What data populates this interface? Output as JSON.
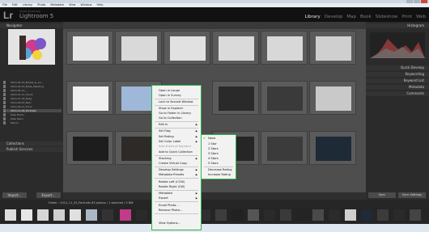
{
  "window": {
    "title": "Lightroom 5 Catalog - Adobe Photoshop Lightroom - Library"
  },
  "menubar": [
    "File",
    "Edit",
    "Library",
    "Photo",
    "Metadata",
    "View",
    "Window",
    "Help"
  ],
  "identity": {
    "logo": "Lr",
    "product": "Lightroom 5",
    "sub": "Adobe Photoshop"
  },
  "modules": [
    "Library",
    "Develop",
    "Map",
    "Book",
    "Slideshow",
    "Print",
    "Web"
  ],
  "left_panel": {
    "navigator": "Navigator",
    "folders": [
      "2014-04-14_Brides_&_Co...",
      "2014-04-16_Bella_Wedding",
      "2014-05-12_...",
      "2014-07-11_Shoot",
      "2014-07-18_Baby",
      "2014-09-03_Bert",
      "2014-09-11_Prom",
      "2014-11-03_Portraits",
      "Kate Farms",
      "Kate Stern",
      "Manon"
    ],
    "collections": "Collections",
    "publish": "Publish Services",
    "import": "Import...",
    "export": "Export..."
  },
  "right_panel": {
    "histogram": "Histogram",
    "quick_develop": "Quick Develop",
    "keywording": "Keywording",
    "keyword_list": "Keyword List",
    "metadata": "Metadata",
    "comments": "Comments",
    "sync": "Sync",
    "sync_settings": "Sync Settings"
  },
  "filmstrip": {
    "info": "Folder : 2014_11_03_Portraits  63 photos / 1 selected / 0 BW"
  },
  "context_menu": {
    "items": [
      "Open in Loupe",
      "Open in Survey",
      "Lock to Second Window",
      "Show in Explorer",
      "Go to Folder in Library",
      "Go to Collection",
      "Edit In",
      "Set Flag",
      "Set Rating",
      "Set Color Label",
      "Add Shortcut Keyword",
      "Add to Quick Collection",
      "Stacking",
      "Create Virtual Copy",
      "Develop Settings",
      "Metadata Presets",
      "Rotate Left (CCW)",
      "Rotate Right (CW)",
      "Metadata",
      "Export",
      "Email Photo...",
      "Remove Photo...",
      "View Options..."
    ]
  },
  "rating_submenu": {
    "items": [
      "None",
      "1 Star",
      "2 Stars",
      "3 Stars",
      "4 Stars",
      "5 Stars",
      "Decrease Rating",
      "Increase Rating"
    ]
  },
  "colors": {
    "accent": "#2db44a",
    "panel": "#2b2b2b",
    "grid": "#4e4e4e"
  }
}
